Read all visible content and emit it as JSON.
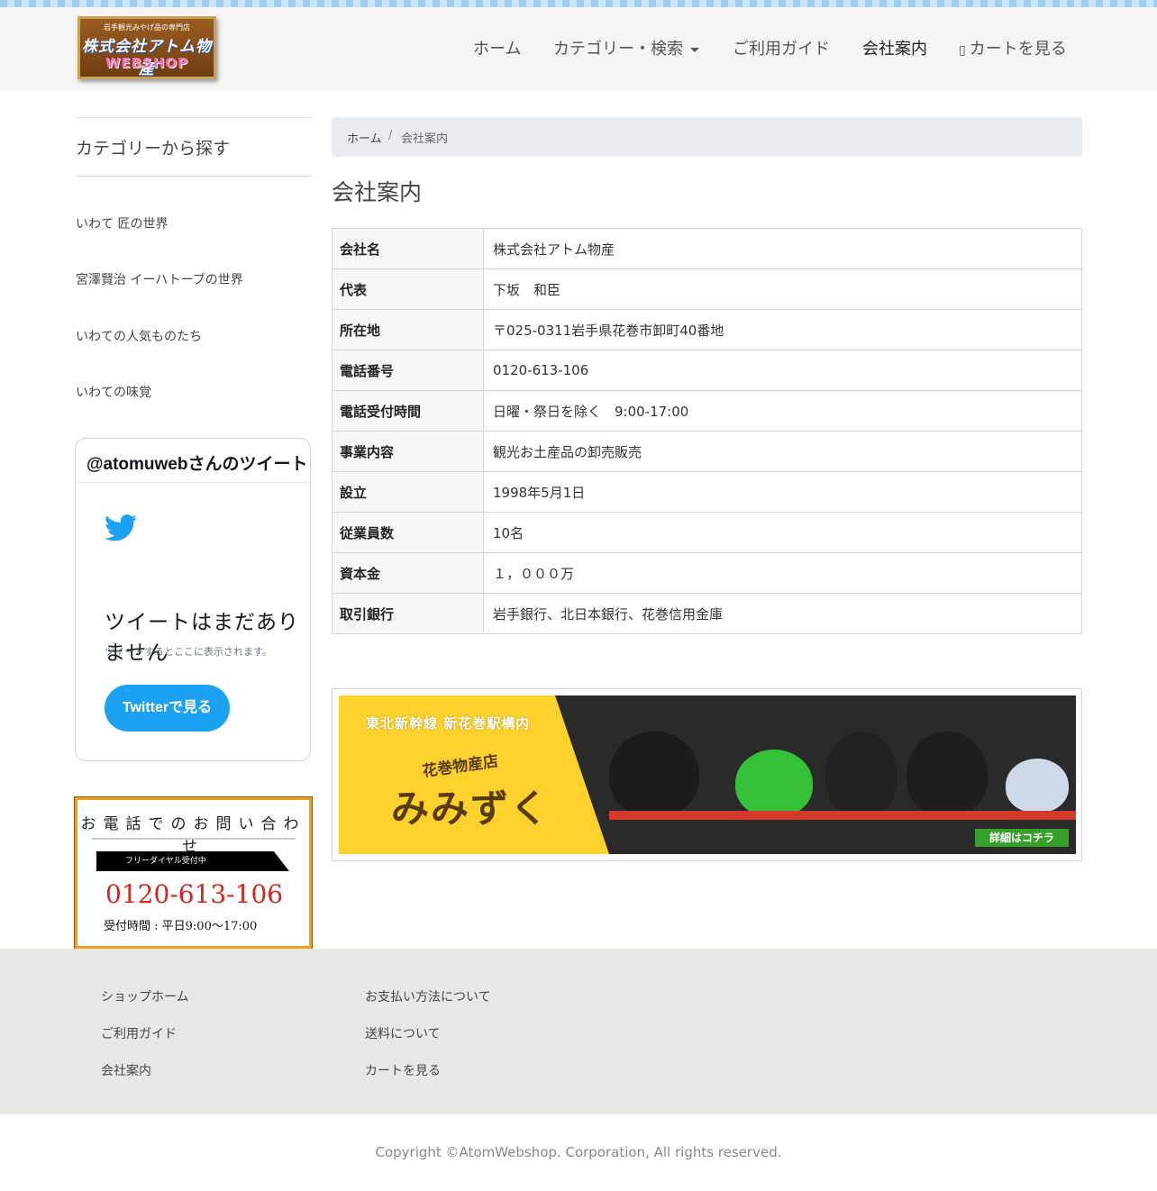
{
  "header": {
    "logo": {
      "tagline": "岩手観光みやげ品の専門店",
      "name": "株式会社アトム物産",
      "sub": "WEBSHOP"
    },
    "nav": [
      {
        "label": "ホーム"
      },
      {
        "label": "カテゴリー・検索"
      },
      {
        "label": "ご利用ガイド"
      },
      {
        "label": "会社案内"
      },
      {
        "label": "カートを見る"
      }
    ]
  },
  "sidebar": {
    "title": "カテゴリーから探す",
    "items": [
      {
        "label": "いわて 匠の世界"
      },
      {
        "label": "宮澤賢治 イーハトーブの世界"
      },
      {
        "label": "いわての人気ものたち"
      },
      {
        "label": "いわての味覚"
      }
    ],
    "twitter": {
      "header": "@atomuwebさんのツイート",
      "big_text": "ツイートはまだありません",
      "small_text": "ツイートするとここに表示されます。",
      "button": "Twitterで見る"
    },
    "contact": {
      "title": "お電話でのお問い合わせ",
      "bar": "フリーダイヤル受付中",
      "phone": "0120-613-106",
      "hours": "受付時間 : 平日9:00〜17:00"
    }
  },
  "breadcrumb": {
    "home": "ホーム",
    "separator": "/",
    "current": "会社案内"
  },
  "page_title": "会社案内",
  "company_table": [
    {
      "key": "会社名",
      "value": "株式会社アトム物産"
    },
    {
      "key": "代表",
      "value": "下坂　和臣"
    },
    {
      "key": "所在地",
      "value": "〒025-0311岩手県花巻市卸町40番地"
    },
    {
      "key": "電話番号",
      "value": "0120-613-106"
    },
    {
      "key": "電話受付時間",
      "value": "日曜・祭日を除く　9:00-17:00"
    },
    {
      "key": "事業内容",
      "value": "観光お土産品の卸売販売"
    },
    {
      "key": "設立",
      "value": "1998年5月1日"
    },
    {
      "key": "従業員数",
      "value": "10名"
    },
    {
      "key": "資本金",
      "value": "１，０００万"
    },
    {
      "key": "取引銀行",
      "value": "岩手銀行、北日本銀行、花巻信用金庫"
    }
  ],
  "banner": {
    "line1": "東北新幹線 新花巻駅構内",
    "line2": "花巻物産店",
    "line3": "みみずく",
    "button": "詳細はコチラ"
  },
  "footer": {
    "col1": [
      {
        "label": "ショップホーム"
      },
      {
        "label": "ご利用ガイド"
      },
      {
        "label": "会社案内"
      }
    ],
    "col2": [
      {
        "label": "お支払い方法について"
      },
      {
        "label": "送料について"
      },
      {
        "label": "カートを見る"
      }
    ],
    "copyright": "Copyright ©AtomWebshop. Corporation, All rights reserved."
  },
  "colors": {
    "twitter_blue": "#1da1f2",
    "phone_red": "#d9261c",
    "contact_border": "#f0a020",
    "footer_bg": "#e8e8e3"
  }
}
